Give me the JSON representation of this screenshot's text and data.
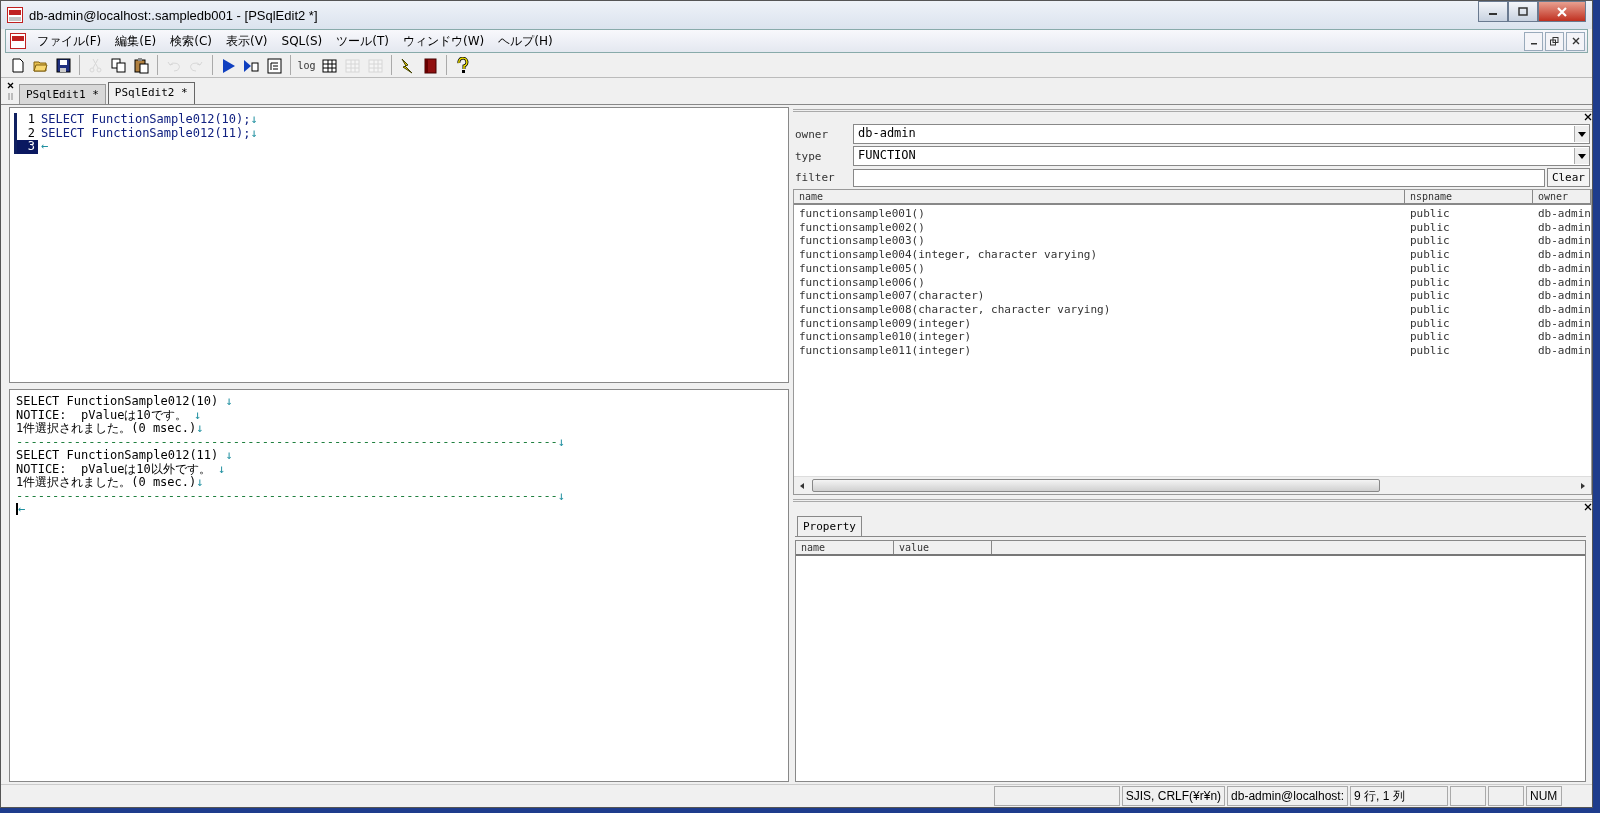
{
  "window": {
    "title": "db-admin@localhost:.sampledb001 - [PSqlEdit2 *]"
  },
  "menu": [
    "ファイル(F)",
    "編集(E)",
    "検索(C)",
    "表示(V)",
    "SQL(S)",
    "ツール(T)",
    "ウィンドウ(W)",
    "ヘルプ(H)"
  ],
  "toolbar": [
    {
      "kind": "new",
      "disabled": false
    },
    {
      "kind": "open",
      "disabled": false
    },
    {
      "kind": "save",
      "disabled": false
    },
    {
      "kind": "sep"
    },
    {
      "kind": "cut",
      "disabled": true
    },
    {
      "kind": "copy",
      "disabled": false
    },
    {
      "kind": "paste",
      "disabled": false
    },
    {
      "kind": "sep"
    },
    {
      "kind": "undo",
      "disabled": true
    },
    {
      "kind": "redo",
      "disabled": true
    },
    {
      "kind": "sep"
    },
    {
      "kind": "run",
      "disabled": false
    },
    {
      "kind": "step",
      "disabled": false
    },
    {
      "kind": "format",
      "disabled": false
    },
    {
      "kind": "sep"
    },
    {
      "kind": "log",
      "label": "log",
      "disabled": false
    },
    {
      "kind": "grid",
      "disabled": false
    },
    {
      "kind": "grid",
      "disabled": true
    },
    {
      "kind": "grid",
      "disabled": true
    },
    {
      "kind": "sep"
    },
    {
      "kind": "bolt",
      "disabled": false
    },
    {
      "kind": "book",
      "disabled": false
    },
    {
      "kind": "sep"
    },
    {
      "kind": "help",
      "disabled": false
    }
  ],
  "tabs": [
    {
      "label": "PSqlEdit1 *",
      "selected": false
    },
    {
      "label": "PSqlEdit2 *",
      "selected": true
    }
  ],
  "editor": {
    "lines": [
      {
        "number": "1",
        "text": "SELECT FunctionSample012(10);",
        "eol": "↓",
        "selected": false
      },
      {
        "number": "2",
        "text": "SELECT FunctionSample012(11);",
        "eol": "↓",
        "selected": false
      },
      {
        "number": "3",
        "eol": "←",
        "selected": true
      }
    ]
  },
  "output": {
    "lines": [
      {
        "text": "SELECT FunctionSample012(10) ",
        "eol": "↓"
      },
      {
        "text": "NOTICE:  pValueは10です。 ",
        "eol": "↓"
      },
      {
        "text": "1件選択されました。(0 msec.)",
        "eol": "↓"
      },
      {
        "text": "---------------------------------------------------------------------------",
        "eol": "↓"
      },
      {
        "text": "SELECT FunctionSample012(11) ",
        "eol": "↓"
      },
      {
        "text": "NOTICE:  pValueは10以外です。 ",
        "eol": "↓"
      },
      {
        "text": "1件選択されました。(0 msec.)",
        "eol": "↓"
      },
      {
        "text": "---------------------------------------------------------------------------",
        "eol": "↓"
      },
      {
        "eol": "←"
      }
    ]
  },
  "browser": {
    "owner": {
      "label": "owner",
      "value": "db-admin"
    },
    "type": {
      "label": "type",
      "value": "FUNCTION"
    },
    "filter": {
      "label": "filter"
    },
    "clear_button": "Clear",
    "columns": [
      "name",
      "nspname",
      "owner"
    ],
    "rows": [
      [
        "functionsample001()",
        "public",
        "db-admin"
      ],
      [
        "functionsample002()",
        "public",
        "db-admin"
      ],
      [
        "functionsample003()",
        "public",
        "db-admin"
      ],
      [
        "functionsample004(integer, character varying)",
        "public",
        "db-admin"
      ],
      [
        "functionsample005()",
        "public",
        "db-admin"
      ],
      [
        "functionsample006()",
        "public",
        "db-admin"
      ],
      [
        "functionsample007(character)",
        "public",
        "db-admin"
      ],
      [
        "functionsample008(character, character varying)",
        "public",
        "db-admin"
      ],
      [
        "functionsample009(integer)",
        "public",
        "db-admin"
      ],
      [
        "functionsample010(integer)",
        "public",
        "db-admin"
      ],
      [
        "functionsample011(integer)",
        "public",
        "db-admin"
      ]
    ]
  },
  "property": {
    "tab": "Property",
    "columns": [
      "name",
      "value"
    ]
  },
  "status_bar": {
    "encoding": "SJIS, CRLF(¥r¥n)",
    "connection": "db-admin@localhost:",
    "position": "9 行, 1 列",
    "num": "NUM"
  }
}
